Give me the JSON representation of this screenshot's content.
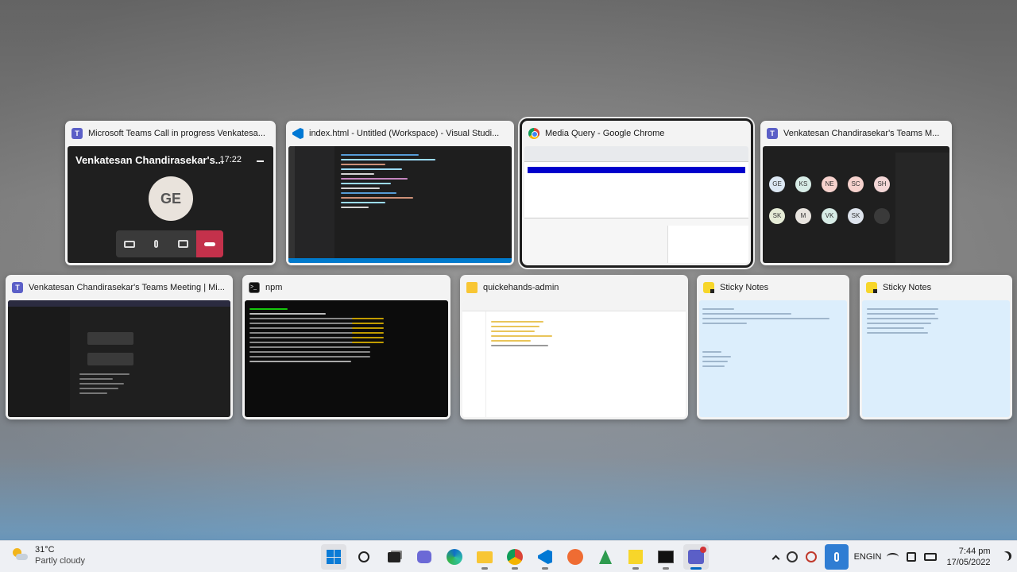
{
  "windows": [
    {
      "title": "Microsoft Teams Call in progress Venkatesa...",
      "app_icon": "teams-icon"
    },
    {
      "title": "index.html - Untitled (Workspace) - Visual Studi...",
      "app_icon": "vscode-icon"
    },
    {
      "title": "Media Query - Google Chrome",
      "app_icon": "chrome-icon",
      "selected": true
    },
    {
      "title": "Venkatesan Chandirasekar's Teams M...",
      "app_icon": "teams-icon"
    },
    {
      "title": "Venkatesan Chandirasekar's Teams Meeting | Mi...",
      "app_icon": "teams-icon"
    },
    {
      "title": "npm",
      "app_icon": "terminal-icon"
    },
    {
      "title": "quickehands-admin",
      "app_icon": "folder-icon"
    },
    {
      "title": "Sticky Notes",
      "app_icon": "sticky-notes-icon"
    },
    {
      "title": "Sticky Notes",
      "app_icon": "sticky-notes-icon"
    }
  ],
  "teams_call": {
    "caller": "Venkatesan Chandirasekar's...",
    "duration": "17:22",
    "avatar_initials": "GE"
  },
  "meeting_participants": [
    "GE",
    "KS",
    "NE",
    "SC",
    "SH",
    "SK",
    "M",
    "VK",
    "SK"
  ],
  "taskbar": {
    "weather_temp": "31°C",
    "weather_desc": "Partly cloudy",
    "apps": [
      "start-icon",
      "search-icon",
      "task-view-icon",
      "chat-icon",
      "edge-icon",
      "file-explorer-icon",
      "chrome-icon",
      "vscode-icon",
      "postman-icon",
      "sourcetree-icon",
      "sticky-notes-icon",
      "terminal-icon",
      "teams-icon"
    ],
    "lang_line1": "ENG",
    "lang_line2": "IN",
    "time": "7:44 pm",
    "date": "17/05/2022"
  },
  "colors": {
    "teams": "#5b5fc7",
    "selection_border": "#1d1d1d",
    "taskbar_accent": "#0067c0",
    "end_call": "#c4314b",
    "chrome_highlight": "#0000cc"
  }
}
